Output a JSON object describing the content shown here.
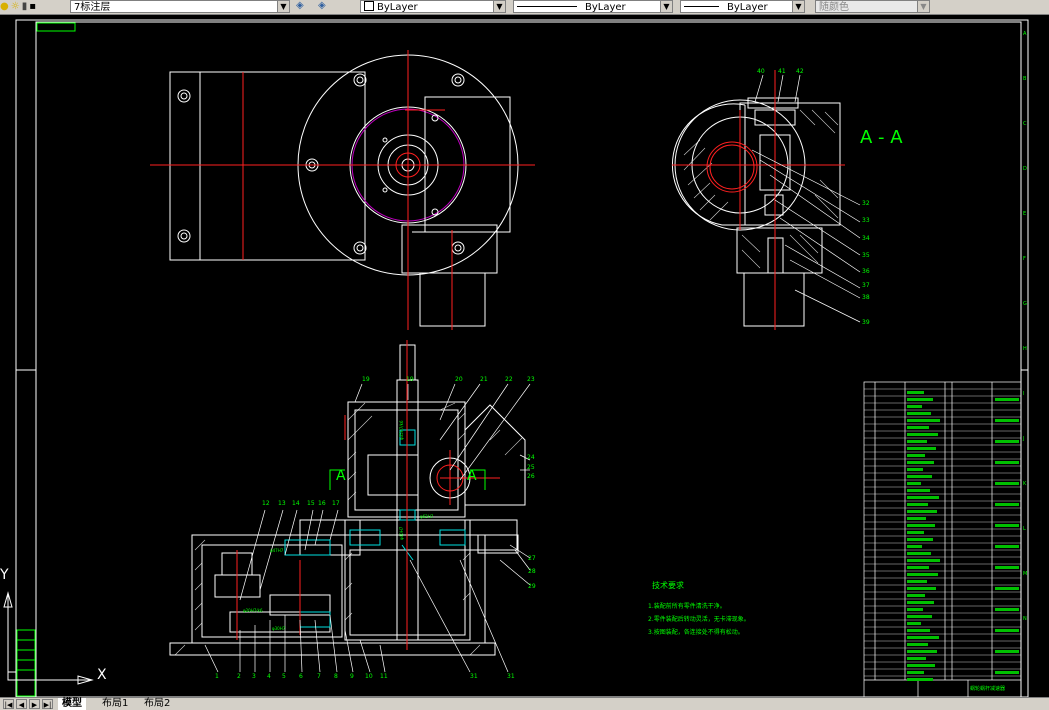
{
  "toolbar": {
    "layer_name": "7标注层",
    "color_value": "ByLayer",
    "linetype_value": "ByLayer",
    "lineweight_value": "ByLayer",
    "plotstyle_value": "随颜色"
  },
  "drawing": {
    "section_label": "A - A",
    "cut_label_left": "A",
    "cut_label_right": "A",
    "requirements_title": "技术要求",
    "requirements": [
      "1.装配前所有零件清洗干净。",
      "2.零件装配后转动灵活，无卡滞现象。",
      "3.按图装配，各连接处不得有松动。"
    ],
    "bom_title": "蜗轮蜗杆减速器"
  },
  "ucs": {
    "x_label": "X",
    "y_label": "Y"
  },
  "tabs": [
    {
      "label": "模型"
    },
    {
      "label": "布局1"
    },
    {
      "label": "布局2"
    }
  ]
}
